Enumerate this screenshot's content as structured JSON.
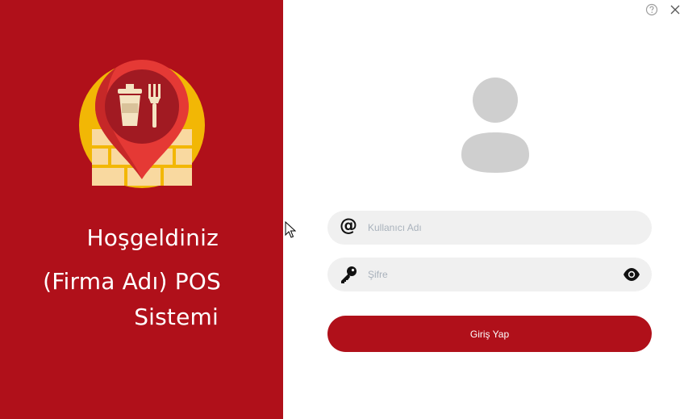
{
  "welcome": {
    "line1": "Hoşgeldiniz",
    "line2": "(Firma Adı) POS",
    "line3": "Sistemi"
  },
  "login": {
    "username_placeholder": "Kullanıcı Adı",
    "username_value": "",
    "username_icon": "@",
    "password_placeholder": "Şifre",
    "password_value": "",
    "submit_label": "Giriş Yap"
  },
  "icons": {
    "logo": "restaurant-location-pin-icon",
    "avatar": "user-avatar-icon",
    "help": "question-circle-icon",
    "close": "close-icon",
    "key": "key-icon",
    "eye": "eye-icon"
  },
  "colors": {
    "brand_red": "#b0101a",
    "field_bg": "#f0f0f0",
    "logo_yellow": "#f2b705",
    "logo_pin_red": "#e53935"
  }
}
